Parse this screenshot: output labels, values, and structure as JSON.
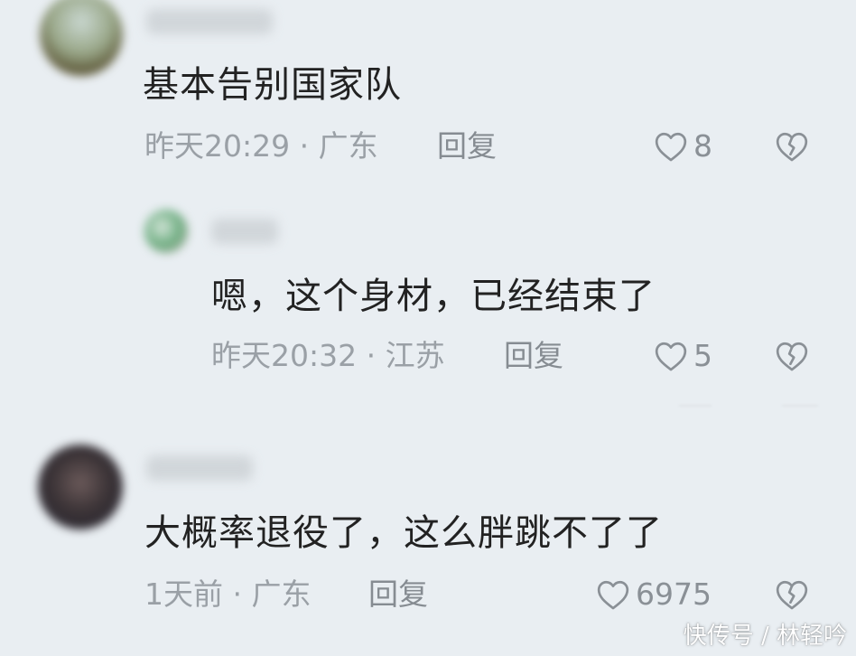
{
  "comments": [
    {
      "text": "基本告别国家队",
      "time_location": "昨天20:29 · 广东",
      "reply_label": "回复",
      "likes": "8"
    },
    {
      "text": "嗯，这个身材，已经结束了",
      "time_location": "昨天20:32 · 江苏",
      "reply_label": "回复",
      "likes": "5"
    },
    {
      "text": "大概率退役了，这么胖跳不了了",
      "time_location": "1天前 · 广东",
      "reply_label": "回复",
      "likes": "6975"
    }
  ],
  "icons": {
    "like": "heart-outline-icon",
    "dislike": "broken-heart-icon"
  },
  "watermark": "快传号 / 林轻吟",
  "colors": {
    "background": "#e9eef2",
    "text": "#222222",
    "meta": "#9aa0a6",
    "icon": "#8a9096"
  }
}
